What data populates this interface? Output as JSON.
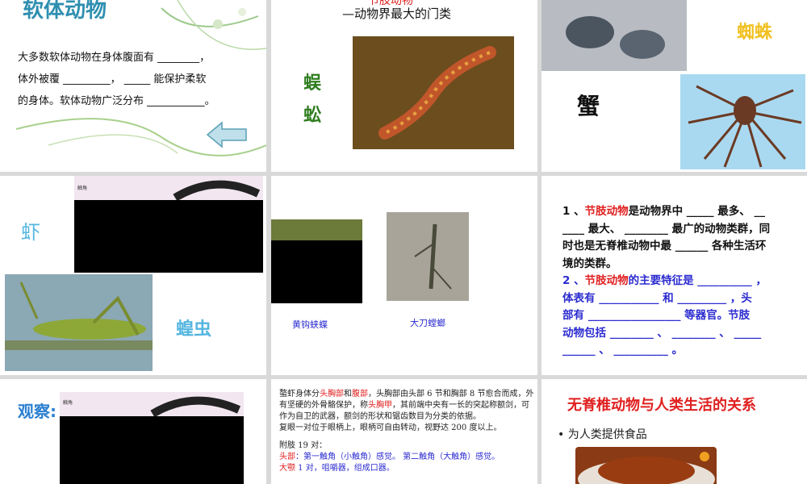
{
  "slide1": {
    "title": "软体动物",
    "para_line1": "大多数软体动物在身体腹面有 ________，",
    "para_line2": "体外被覆 _________， _____ 能保护柔软",
    "para_line3": "的身体。软体动物广泛分布 ___________。",
    "back_arrow_icon": "left-arrow-icon"
  },
  "slide2": {
    "title_top": "节肢动物",
    "subtitle": "—动物界最大的门类",
    "side_label_1": "蜈",
    "side_label_2": "蚣"
  },
  "slide3": {
    "spider_label": "蜘蛛",
    "crab_label": "蟹"
  },
  "slide4": {
    "shrimp_label": "虾",
    "locust_label": "蝗虫",
    "diagram_caption": "触角"
  },
  "slide5": {
    "butterfly_caption": "黄钩蛱蝶",
    "mantis_caption": "大刀螳螂"
  },
  "slide6": {
    "q1_num": "1 、",
    "q1_term": "节肢动物",
    "q1_a": "是动物界中 _____ 最多、 __",
    "q1_b": "____ 最大、 ________ 最广的动物类群，同",
    "q1_c": "时也是无脊椎动物中最 ______ 各种生活环",
    "q1_d": "境的类群。",
    "q2_num": "2 、",
    "q2_term": "节肢动物",
    "q2_a": "的主要特征是 __________ ，",
    "q2_b": "体表有 ___________ 和 _________ ，头",
    "q2_c": "部有 _________________ 等器官。节肢",
    "q2_d": "动物包括 ________ 、 ________ 、 _____",
    "q2_e": "______ 、 __________ 。"
  },
  "slide7": {
    "observe_label": "观察:",
    "diagram_caption": "触角"
  },
  "slide8": {
    "p1_a": "螯虾身体分",
    "p1_head_thorax": "头胸部",
    "p1_and": "和",
    "p1_abdomen": "腹部",
    "p1_b": "，头胸部由头部 6 节和胸部 8 节愈合而成，外有坚硬的外骨骼保护，称",
    "p1_carapace": "头胸甲",
    "p1_c": "，其前端中央有一长的突起称额剑，可作为自卫的武器，额剑的形状和锯齿数目为分类的依据。",
    "p2": "复眼一对位于眼柄上，眼柄可自由转动，视野达 200 度以上。",
    "p3": "附肢 19 对：",
    "p4_head": "头部",
    "p4_a": "：第一触角（小触角）感觉。 第二触角（大触角）感觉。",
    "p5_jaw": "大颚",
    "p5_a": " 1 对，咀嚼器，组成口器。"
  },
  "slide9": {
    "title": "无脊椎动物与人类生活的关系",
    "bullet": "• 为人类提供食品"
  },
  "colors": {
    "red": "#e02020",
    "blue": "#2b2bd0",
    "light_blue": "#55b6e0",
    "green": "#2e7d1e",
    "yellow": "#f0c020"
  }
}
